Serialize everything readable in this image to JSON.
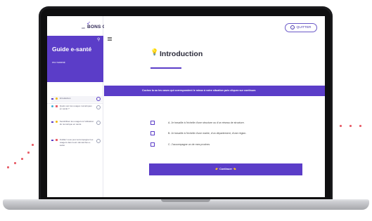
{
  "app": {
    "logo_small": "LES",
    "logo_text": "BONS CLICS",
    "quit_label": "QUITTER"
  },
  "sidebar": {
    "title": "Guide e-santé",
    "subtitle": "PAS TERMINÉ",
    "items": [
      {
        "label": "Introduction",
        "color": "#f2b705"
      },
      {
        "label": "Quels sont les usages numériques en santé ?",
        "color": "#3fb0d6"
      },
      {
        "label": "Sensibiliser les usagers à l'utilisation du numérique en santé",
        "color": "#f2b705"
      },
      {
        "label": "Outillez vous pour accompagner les usagers dans leurs démarches e-santé",
        "color": "#e8606a"
      }
    ]
  },
  "main": {
    "title": "Introduction",
    "instruction": "Cochez la ou les cases qui correspondent le mieux à votre situation puis cliquez sur continuer.",
    "options": [
      "A. Je travaille à l'échelle d'une structure ou d'un réseau de structure.",
      "B. Je travaille à l'échelle d'une mairie, d'un département, d'une région.",
      "C. J'accompagne un de mes proches"
    ],
    "continue_label": "Continuer"
  },
  "colors": {
    "accent": "#5b3dc8",
    "bulb": "#f2b705",
    "decor_dots": "#e8606a"
  }
}
